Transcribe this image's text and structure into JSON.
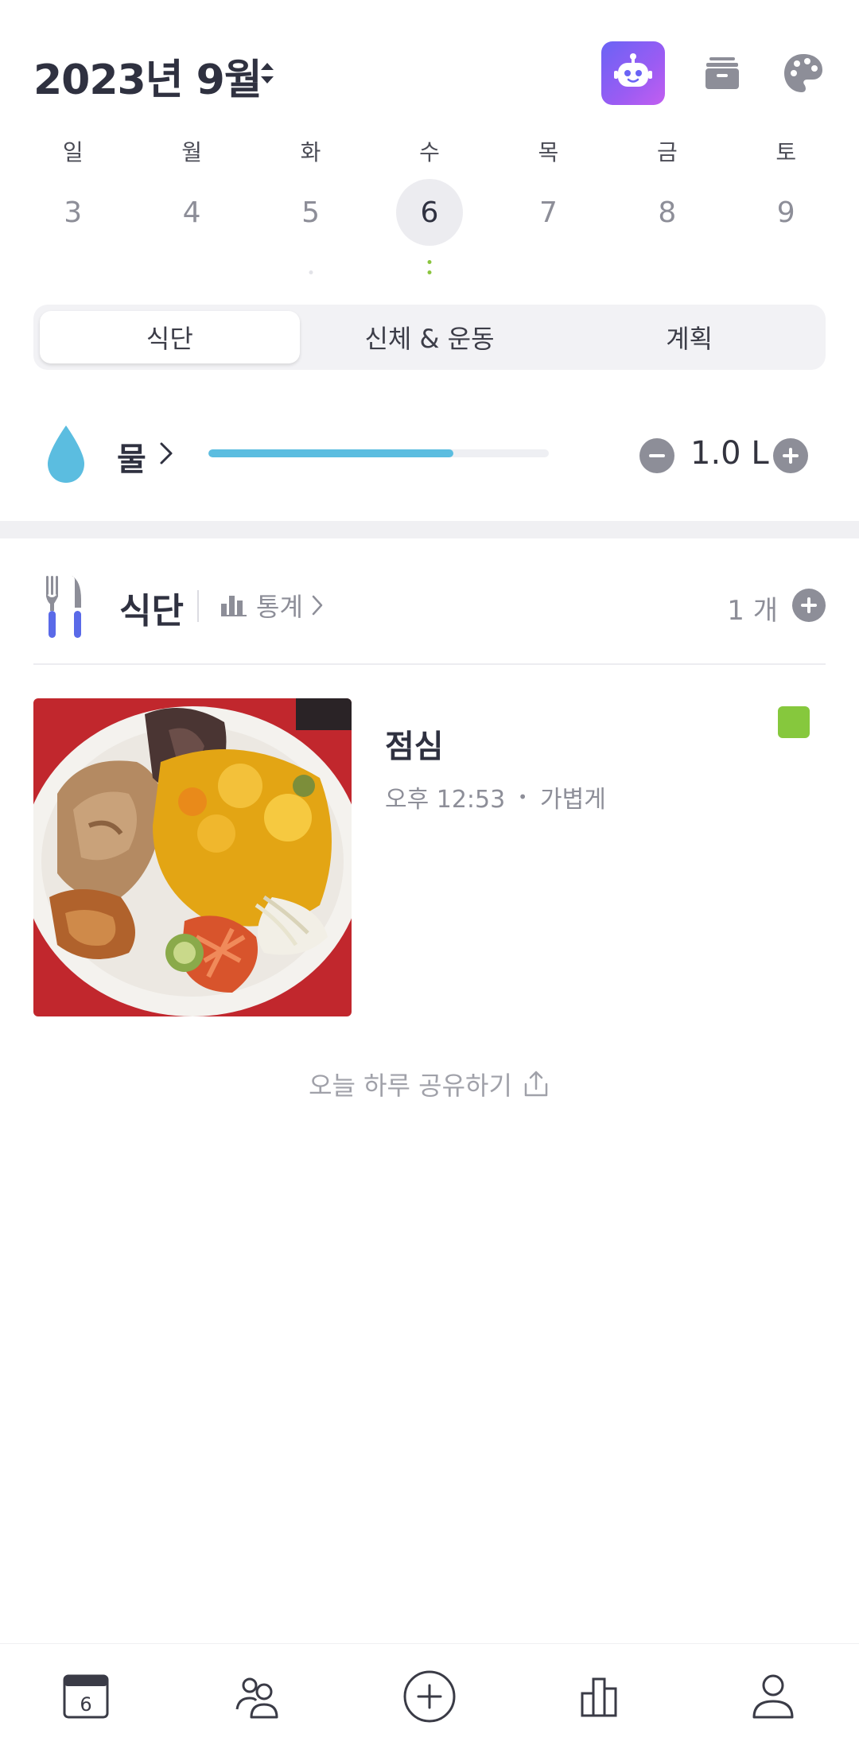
{
  "header": {
    "month_title": "2023년 9월",
    "icons": [
      "robot-icon",
      "archive-icon",
      "palette-icon"
    ]
  },
  "week": {
    "days": [
      {
        "name": "일",
        "num": "3"
      },
      {
        "name": "월",
        "num": "4"
      },
      {
        "name": "화",
        "num": "5"
      },
      {
        "name": "수",
        "num": "6"
      },
      {
        "name": "목",
        "num": "7"
      },
      {
        "name": "금",
        "num": "8"
      },
      {
        "name": "토",
        "num": "9"
      }
    ],
    "selected_index": 3
  },
  "tabs": [
    {
      "label": "식단",
      "active": true
    },
    {
      "label": "신체 & 운동",
      "active": false
    },
    {
      "label": "계획",
      "active": false
    }
  ],
  "water": {
    "label": "물",
    "amount": "1.0 L",
    "progress": 0.72,
    "color": "#5bbde0"
  },
  "meals": {
    "title": "식단",
    "stats_label": "통계",
    "count": "1 개",
    "items": [
      {
        "name": "점심",
        "time": "오후 12:53",
        "size": "가볍게",
        "status_color": "#86c83d"
      }
    ]
  },
  "share": {
    "label": "오늘 하루 공유하기"
  },
  "bottom_nav": {
    "calendar_day": "6",
    "items": [
      "calendar-icon",
      "community-icon",
      "add-icon",
      "stats-icon",
      "profile-icon"
    ]
  }
}
